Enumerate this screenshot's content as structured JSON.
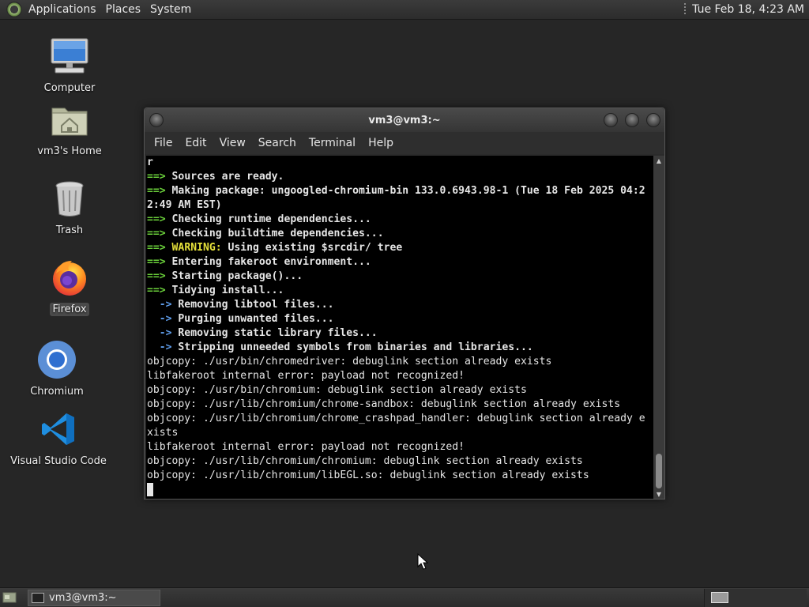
{
  "top_panel": {
    "menus": [
      "Applications",
      "Places",
      "System"
    ],
    "clock": "Tue Feb 18,  4:23 AM"
  },
  "desktop_icons": [
    {
      "label": "Computer",
      "icon": "computer-icon"
    },
    {
      "label": "vm3's Home",
      "icon": "home-folder-icon"
    },
    {
      "label": "Trash",
      "icon": "trash-icon"
    },
    {
      "label": "Firefox",
      "icon": "firefox-icon",
      "selected": true
    },
    {
      "label": "Chromium",
      "icon": "chromium-icon"
    },
    {
      "label": "Visual Studio Code",
      "icon": "vscode-icon"
    }
  ],
  "terminal": {
    "title": "vm3@vm3:~",
    "menus": [
      "File",
      "Edit",
      "View",
      "Search",
      "Terminal",
      "Help"
    ],
    "lines": [
      {
        "text": "r",
        "parts": []
      },
      {
        "prefix": "==> ",
        "text": "Sources are ready."
      },
      {
        "prefix": "==> ",
        "text": "Making package: ungoogled-chromium-bin 133.0.6943.98-1 (Tue 18 Feb 2025 04:2"
      },
      {
        "text": "2:49 AM EST)"
      },
      {
        "prefix": "==> ",
        "text": "Checking runtime dependencies..."
      },
      {
        "prefix": "==> ",
        "text": "Checking buildtime dependencies..."
      },
      {
        "prefix": "==> ",
        "warning": "WARNING:",
        "text": " Using existing $srcdir/ tree"
      },
      {
        "prefix": "==> ",
        "text": "Entering fakeroot environment..."
      },
      {
        "prefix": "==> ",
        "text": "Starting package()..."
      },
      {
        "prefix": "==> ",
        "text": "Tidying install..."
      },
      {
        "sub": "  -> ",
        "text": "Removing libtool files..."
      },
      {
        "sub": "  -> ",
        "text": "Purging unwanted files..."
      },
      {
        "sub": "  -> ",
        "text": "Removing static library files..."
      },
      {
        "sub": "  -> ",
        "text": "Stripping unneeded symbols from binaries and libraries..."
      },
      {
        "plain": "objcopy: ./usr/bin/chromedriver: debuglink section already exists"
      },
      {
        "plain": "libfakeroot internal error: payload not recognized!"
      },
      {
        "plain": "objcopy: ./usr/bin/chromium: debuglink section already exists"
      },
      {
        "plain": "objcopy: ./usr/lib/chromium/chrome-sandbox: debuglink section already exists"
      },
      {
        "plain": "objcopy: ./usr/lib/chromium/chrome_crashpad_handler: debuglink section already e"
      },
      {
        "plain": "xists"
      },
      {
        "plain": "libfakeroot internal error: payload not recognized!"
      },
      {
        "plain": "objcopy: ./usr/lib/chromium/chromium: debuglink section already exists"
      },
      {
        "plain": "objcopy: ./usr/lib/chromium/libEGL.so: debuglink section already exists"
      }
    ]
  },
  "taskbar": {
    "task_label": "vm3@vm3:~"
  },
  "colors": {
    "arrow_green": "#6bd13b",
    "warning_yellow": "#e5e03a",
    "sub_arrow_blue": "#5e9be8",
    "terminal_bg": "#000000"
  }
}
